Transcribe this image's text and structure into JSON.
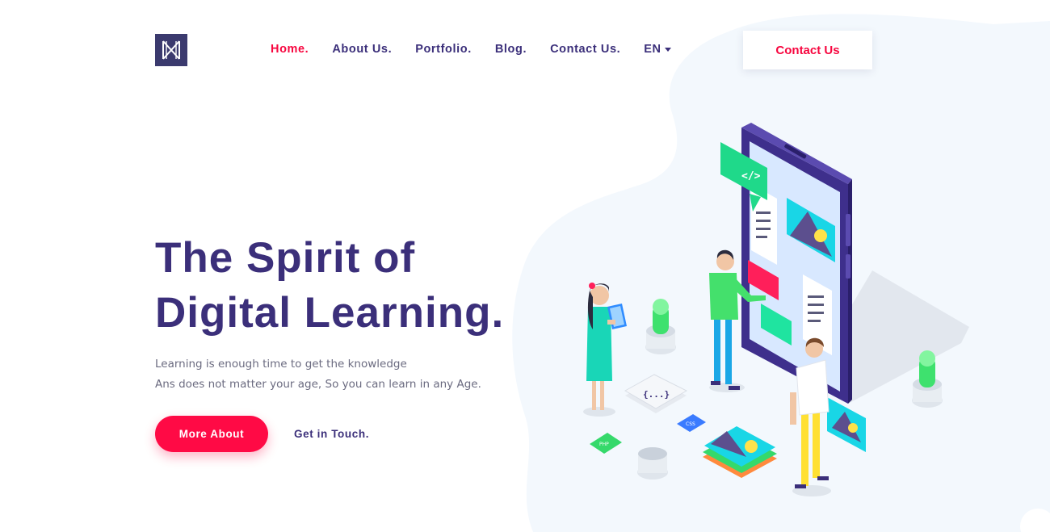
{
  "logo": {
    "icon": "brand-logo-icon"
  },
  "nav": {
    "items": [
      {
        "label": "Home.",
        "active": true
      },
      {
        "label": "About Us.",
        "active": false
      },
      {
        "label": "Portfolio.",
        "active": false
      },
      {
        "label": "Blog.",
        "active": false
      },
      {
        "label": "Contact Us.",
        "active": false
      }
    ],
    "language": "EN"
  },
  "header": {
    "contact_button": "Contact Us"
  },
  "hero": {
    "title_line1": "The Spirit of",
    "title_line2": "Digital Learning.",
    "subtitle_line1": "Learning is enough time to get the knowledge",
    "subtitle_line2": "Ans does not matter your age, So you can learn in any Age.",
    "primary_button": "More About",
    "secondary_link": "Get in Touch."
  },
  "illustration": {
    "code_bubble": "</>",
    "braces_block": "{...}",
    "php_tag": "PHP",
    "css_tag": "CSS"
  },
  "colors": {
    "accent": "#f7063f",
    "primary": "#3b2f7a",
    "blob": "#f3f8fd",
    "phone": "#3e2f8c",
    "green": "#22e07a",
    "teal": "#19d6b7"
  }
}
